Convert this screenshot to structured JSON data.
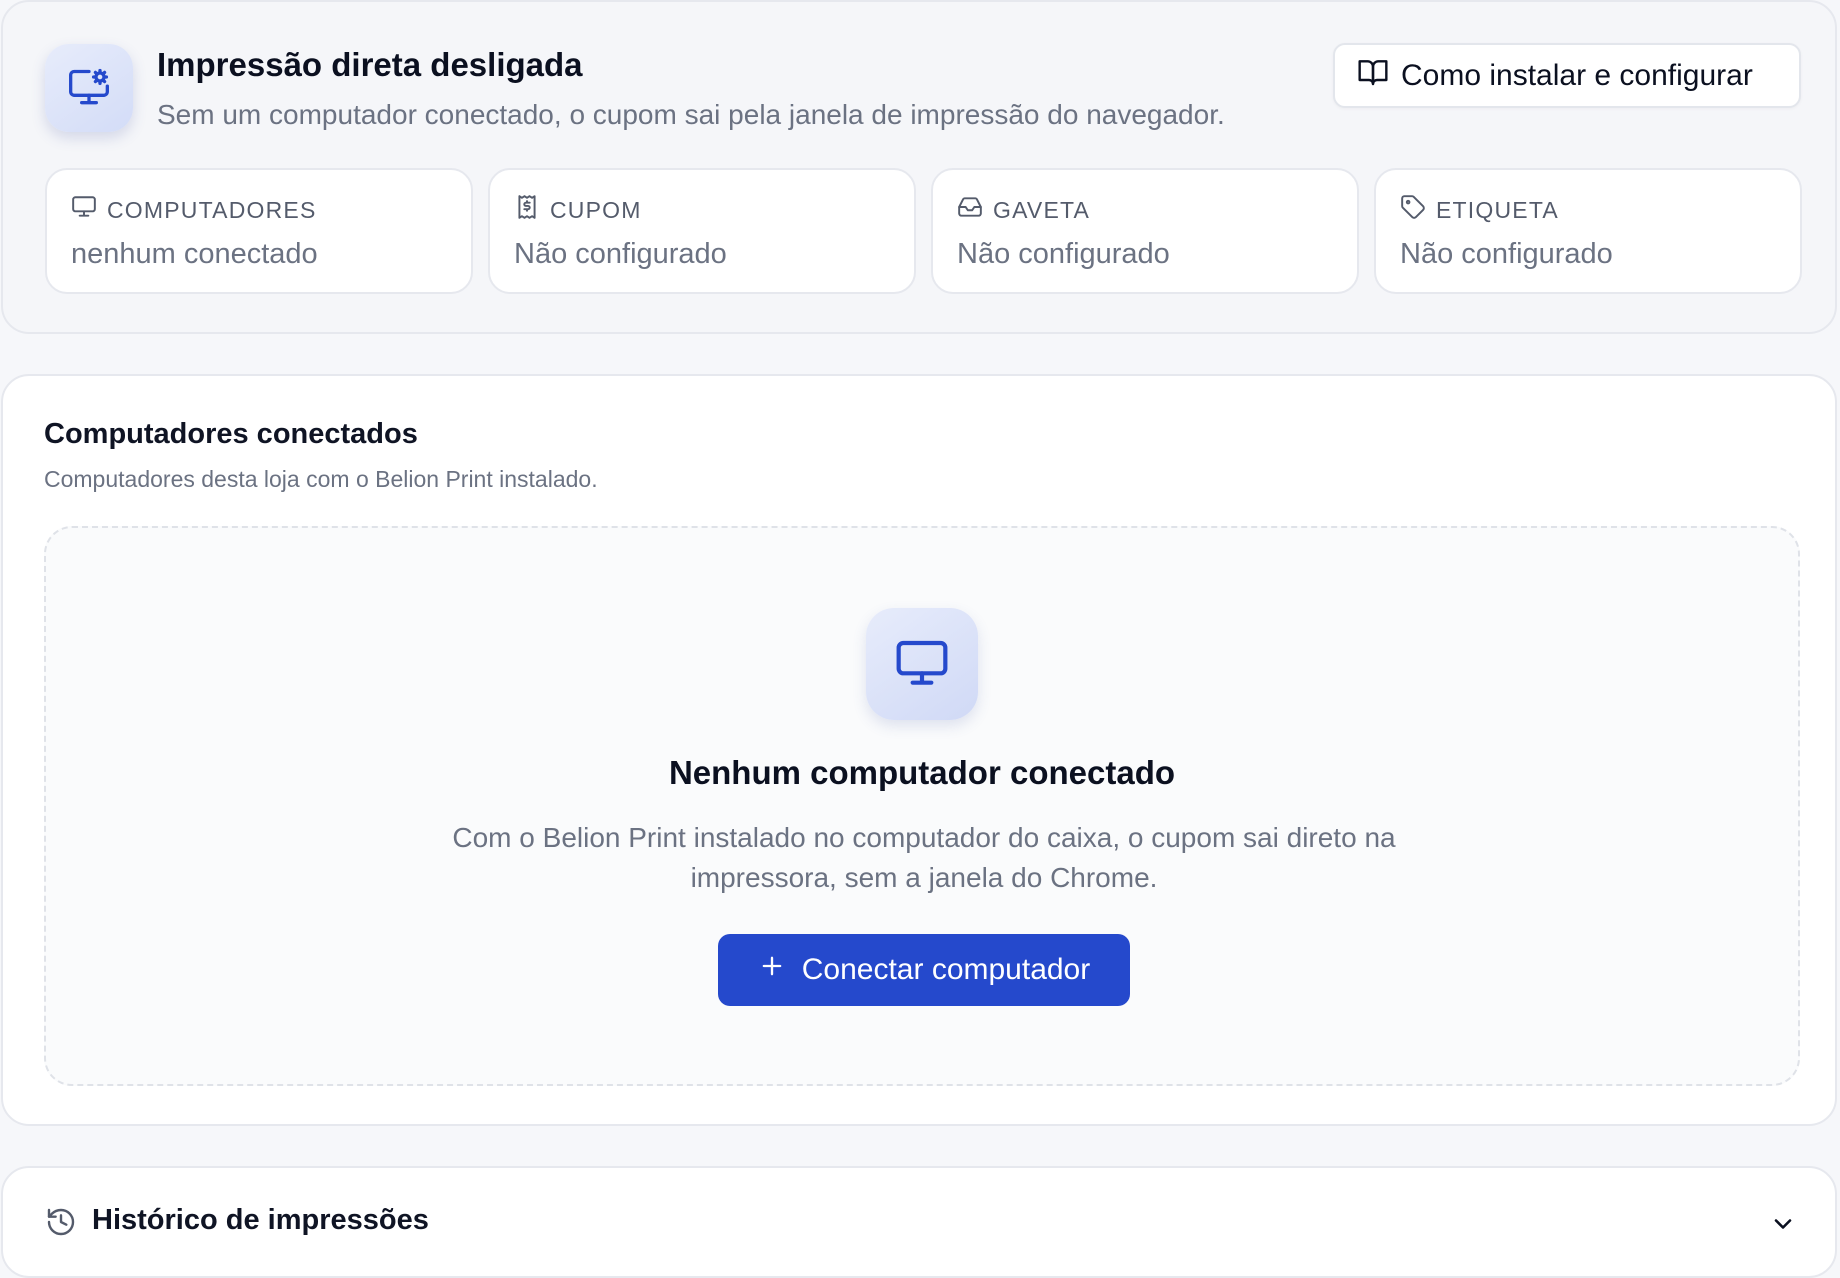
{
  "status": {
    "title": "Impressão direta desligada",
    "subtitle": "Sem um computador conectado, o cupom sai pela janela de impressão do navegador.",
    "install_button": "Como instalar e configurar",
    "icon": "monitor-cog-icon",
    "stats": [
      {
        "label": "COMPUTADORES",
        "value": "nenhum conectado",
        "icon": "monitor-icon"
      },
      {
        "label": "CUPOM",
        "value": "Não configurado",
        "icon": "receipt-icon"
      },
      {
        "label": "GAVETA",
        "value": "Não configurado",
        "icon": "inbox-icon"
      },
      {
        "label": "ETIQUETA",
        "value": "Não configurado",
        "icon": "tag-icon"
      }
    ]
  },
  "computers": {
    "title": "Computadores conectados",
    "subtitle": "Computadores desta loja com o Belion Print instalado.",
    "empty_title": "Nenhum computador conectado",
    "empty_text": "Com o Belion Print instalado no computador do caixa, o cupom sai direto na impressora, sem a janela do Chrome.",
    "connect_button": "Conectar computador"
  },
  "history": {
    "title": "Histórico de impressões"
  },
  "colors": {
    "accent": "#2549cc",
    "muted_text": "#6b7282",
    "border": "#e6e8ee"
  }
}
